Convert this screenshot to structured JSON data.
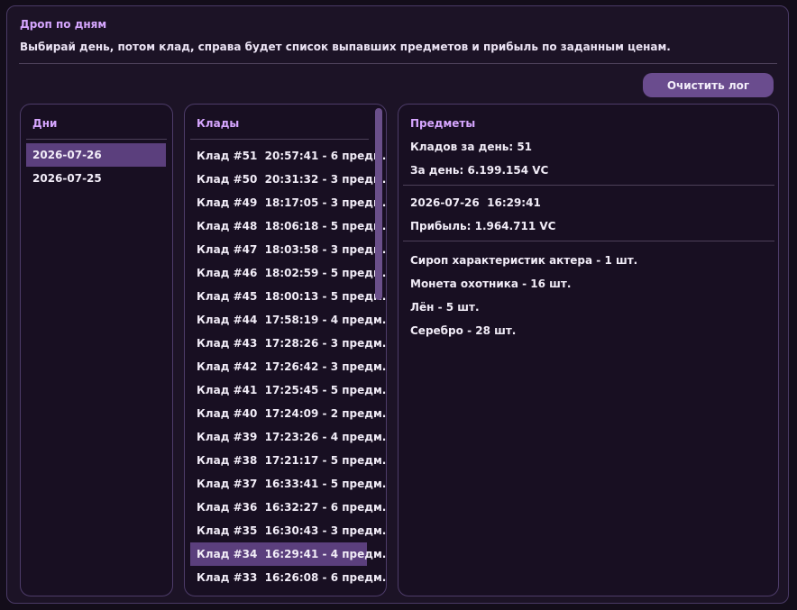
{
  "window": {
    "title": "Дроп по дням",
    "subtitle": "Выбирай день, потом клад, справа будет список выпавших предметов и прибыль по заданным ценам.",
    "clear_button": "Очистить лог"
  },
  "days": {
    "header": "Дни",
    "items": [
      "2026-07-26",
      "2026-07-25"
    ],
    "selected_index": 0
  },
  "drops": {
    "header": "Клады",
    "items": [
      "Клад #51  20:57:41 - 6 предм.",
      "Клад #50  20:31:32 - 3 предм.",
      "Клад #49  18:17:05 - 3 предм.",
      "Клад #48  18:06:18 - 5 предм.",
      "Клад #47  18:03:58 - 3 предм.",
      "Клад #46  18:02:59 - 5 предм.",
      "Клад #45  18:00:13 - 5 предм.",
      "Клад #44  17:58:19 - 4 предм.",
      "Клад #43  17:28:26 - 3 предм.",
      "Клад #42  17:26:42 - 3 предм.",
      "Клад #41  17:25:45 - 5 предм.",
      "Клад #40  17:24:09 - 2 предм.",
      "Клад #39  17:23:26 - 4 предм.",
      "Клад #38  17:21:17 - 5 предм.",
      "Клад #37  16:33:41 - 5 предм.",
      "Клад #36  16:32:27 - 6 предм.",
      "Клад #35  16:30:43 - 3 предм.",
      "Клад #34  16:29:41 - 4 предм.",
      "Клад #33  16:26:08 - 6 предм."
    ],
    "selected_index": 17
  },
  "items_panel": {
    "header": "Предметы",
    "day_count": "Кладов за день: 51",
    "day_total": "За день: 6.199.154 VC",
    "drop_time": "2026-07-26  16:29:41",
    "drop_profit": "Прибыль: 1.964.711 VC",
    "loot": [
      "Сироп характеристик актера - 1 шт.",
      "Монета охотника - 16 шт.",
      "Лён - 5 шт.",
      "Серебро - 28 шт."
    ]
  },
  "colors": {
    "accent": "#d6a6ff",
    "selected": "#5b3f7d",
    "button": "#6a4c8e",
    "background": "#1c1326"
  }
}
